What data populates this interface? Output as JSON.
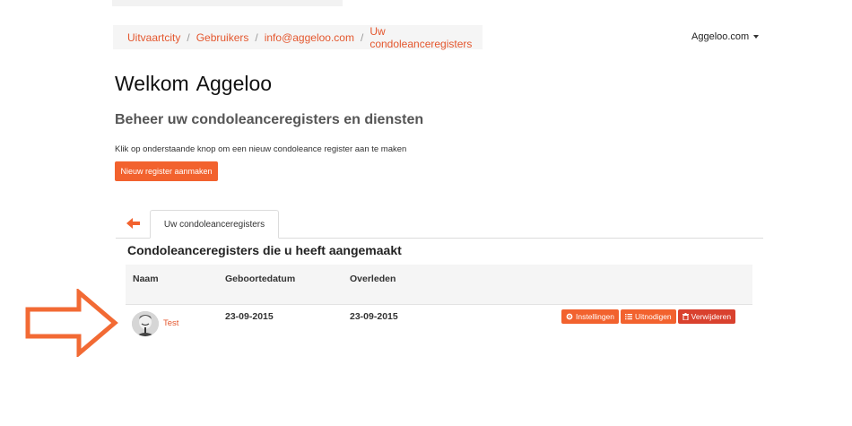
{
  "breadcrumb": {
    "items": [
      "Uitvaartcity",
      "Gebruikers",
      "info@aggeloo.com",
      "Uw condoleanceregisters"
    ],
    "separator": "/"
  },
  "account": {
    "label": "Aggeloo.com"
  },
  "welcome": {
    "prefix": "Welkom",
    "name": "Aggeloo"
  },
  "subheading": "Beheer uw condoleanceregisters en diensten",
  "hint": "Klik op onderstaande knop om een nieuw condoleance register aan te maken",
  "new_button": "Nieuw register aanmaken",
  "tabs": [
    {
      "label": "Uw condoleanceregisters",
      "active": true
    }
  ],
  "section_title": "Condoleanceregisters die u heeft aangemaakt",
  "table": {
    "columns": [
      "Naam",
      "Geboortedatum",
      "Overleden"
    ],
    "rows": [
      {
        "name": "Test",
        "birth": "23-09-2015",
        "died": "23-09-2015",
        "actions": [
          "Instellingen",
          "Uitnodigen",
          "Verwijderen"
        ]
      }
    ]
  },
  "colors": {
    "accent": "#f2622e",
    "danger": "#d9412e",
    "link": "#e4572e"
  }
}
